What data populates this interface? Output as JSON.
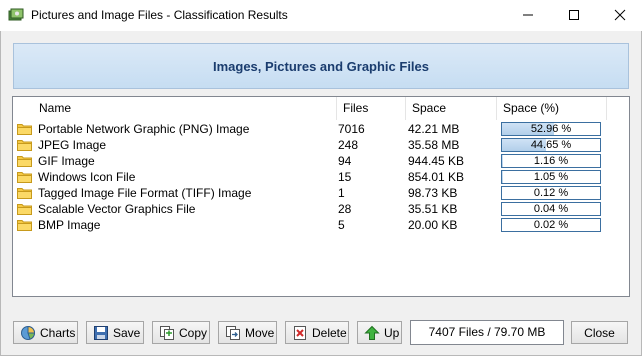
{
  "window": {
    "title": "Pictures and Image Files - Classification Results"
  },
  "banner": {
    "title": "Images, Pictures and Graphic Files"
  },
  "table": {
    "columns": [
      "Name",
      "Files",
      "Space",
      "Space (%)"
    ],
    "rows": [
      {
        "name": "Portable Network Graphic (PNG) Image",
        "files": "7016",
        "space": "42.21 MB",
        "pct_label": "52.96 %",
        "pct": 52.96
      },
      {
        "name": "JPEG Image",
        "files": "248",
        "space": "35.58 MB",
        "pct_label": "44.65 %",
        "pct": 44.65
      },
      {
        "name": "GIF Image",
        "files": "94",
        "space": "944.45 KB",
        "pct_label": "1.16 %",
        "pct": 1.16
      },
      {
        "name": "Windows Icon File",
        "files": "15",
        "space": "854.01 KB",
        "pct_label": "1.05 %",
        "pct": 1.05
      },
      {
        "name": "Tagged Image File Format (TIFF) Image",
        "files": "1",
        "space": "98.73 KB",
        "pct_label": "0.12 %",
        "pct": 0.12
      },
      {
        "name": "Scalable Vector Graphics File",
        "files": "28",
        "space": "35.51 KB",
        "pct_label": "0.04 %",
        "pct": 0.04
      },
      {
        "name": "BMP Image",
        "files": "5",
        "space": "20.00 KB",
        "pct_label": "0.02 %",
        "pct": 0.02
      }
    ]
  },
  "toolbar": {
    "charts_label": "Charts",
    "save_label": "Save",
    "copy_label": "Copy",
    "move_label": "Move",
    "delete_label": "Delete",
    "up_label": "Up",
    "summary": "7407 Files / 79.70 MB",
    "close_label": "Close"
  },
  "icons": {
    "row_icon": "folder-icon",
    "charts": "chart-icon",
    "save": "floppy-disk-icon",
    "copy": "copy-icon",
    "move": "move-icon",
    "delete": "delete-icon",
    "up": "up-arrow-icon"
  },
  "colors": {
    "folder": "#f5c944",
    "banner_text": "#1a3c6e",
    "pct_border": "#3b6fa0",
    "up_arrow": "#2e9a2e",
    "delete_x": "#d02a2a"
  }
}
